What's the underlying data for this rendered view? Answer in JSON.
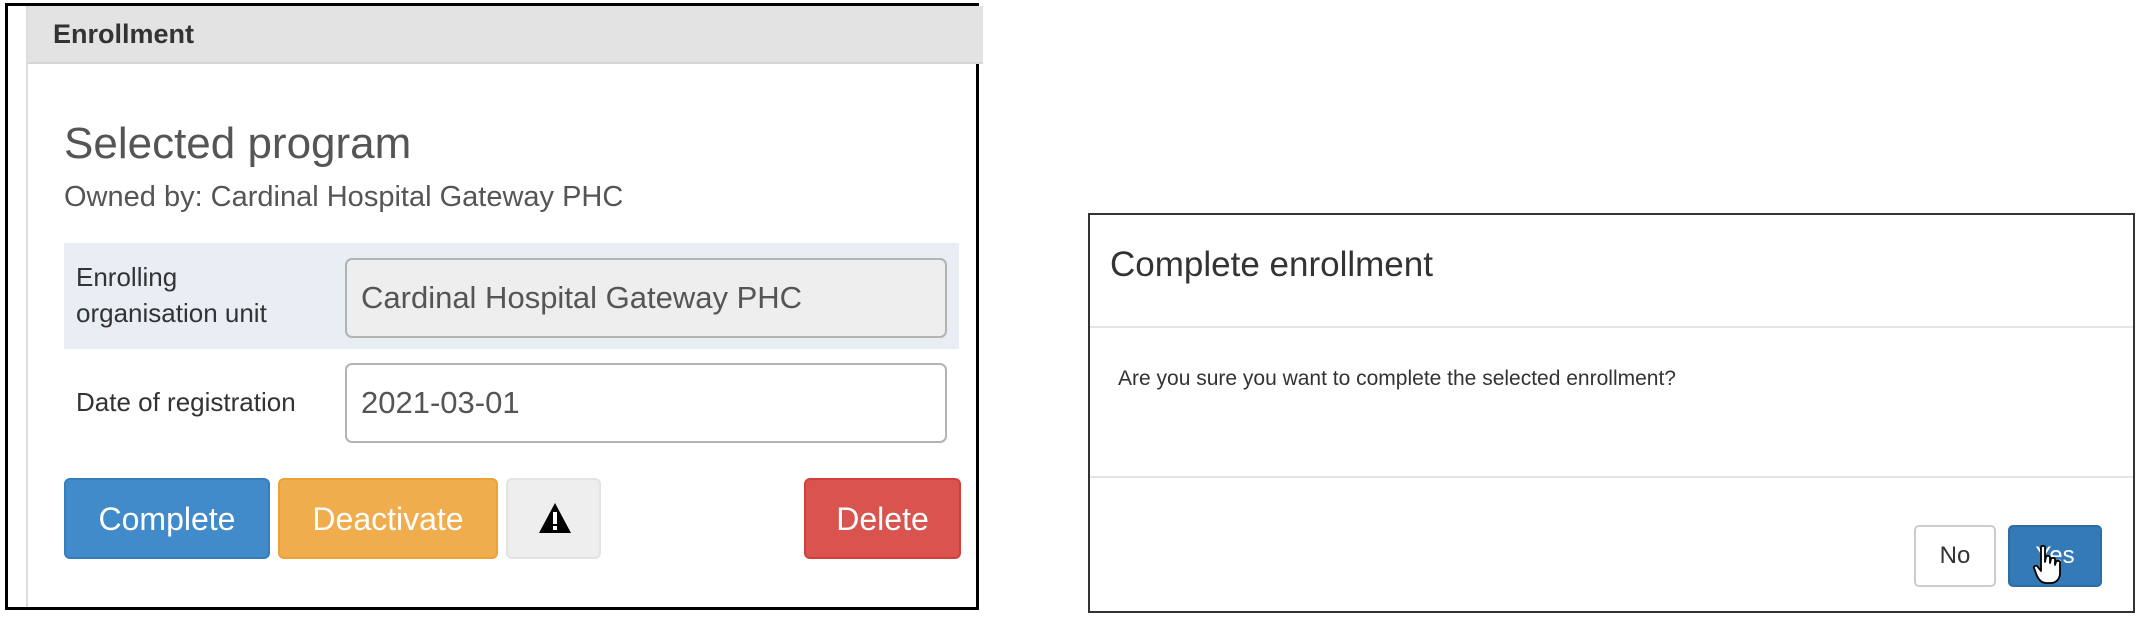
{
  "enrollment_panel": {
    "heading": "Enrollment",
    "program_title": "Selected program",
    "owned_by": "Owned by: Cardinal Hospital Gateway PHC",
    "enrolling_org_label_line1": "Enrolling",
    "enrolling_org_label_line2": "organisation unit",
    "enrolling_org_value": "Cardinal Hospital Gateway PHC",
    "date_label": "Date of registration",
    "date_value": "2021-03-01",
    "buttons": {
      "complete": "Complete",
      "deactivate": "Deactivate",
      "warning_icon": "warning-triangle-icon",
      "delete": "Delete"
    }
  },
  "dialog": {
    "title": "Complete enrollment",
    "message": "Are you sure you want to complete the selected enrollment?",
    "no_label": "No",
    "yes_label": "Yes",
    "cursor_icon": "hand-pointer-icon"
  },
  "colors": {
    "complete": "#428bca",
    "deactivate": "#f0ad4e",
    "delete": "#d9534f",
    "yes": "#337ab7"
  }
}
